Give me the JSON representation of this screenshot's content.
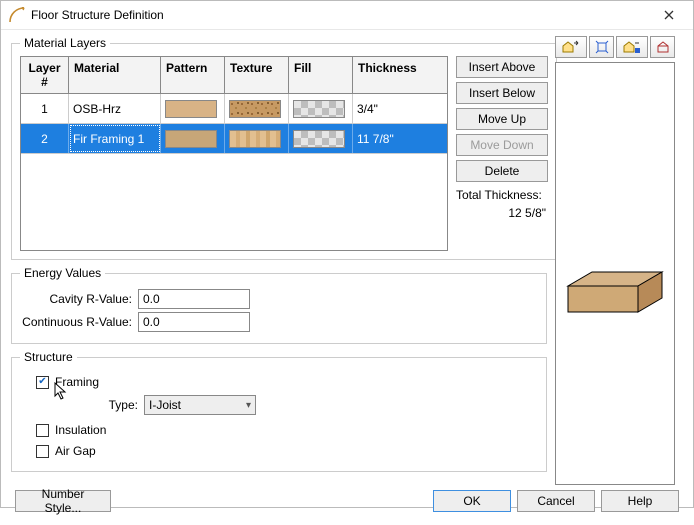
{
  "window": {
    "title": "Floor Structure Definition"
  },
  "sections": {
    "materialLayers": "Material Layers",
    "energyValues": "Energy Values",
    "structure": "Structure"
  },
  "grid": {
    "headers": {
      "layer": "Layer #",
      "material": "Material",
      "pattern": "Pattern",
      "texture": "Texture",
      "fill": "Fill",
      "thickness": "Thickness"
    },
    "rows": [
      {
        "layer": "1",
        "material": "OSB-Hrz",
        "pattern": "wood-light",
        "texture": "osb",
        "fill": "check",
        "thickness": "3/4\"",
        "selected": false
      },
      {
        "layer": "2",
        "material": "Fir Framing 1",
        "pattern": "wood-tan",
        "texture": "fir",
        "fill": "check",
        "thickness": "11 7/8\"",
        "selected": true
      }
    ]
  },
  "sideButtons": {
    "insertAbove": "Insert Above",
    "insertBelow": "Insert Below",
    "moveUp": "Move Up",
    "moveDown": "Move Down",
    "delete": "Delete",
    "totalLabel": "Total Thickness:",
    "totalValue": "12 5/8\""
  },
  "energy": {
    "cavityLabel": "Cavity R-Value:",
    "cavityValue": "0.0",
    "contLabel": "Continuous R-Value:",
    "contValue": "0.0"
  },
  "structure": {
    "framingLabel": "Framing",
    "framingChecked": true,
    "typeLabel": "Type:",
    "typeValue": "I-Joist",
    "insulationLabel": "Insulation",
    "insulationChecked": false,
    "airGapLabel": "Air Gap",
    "airGapChecked": false
  },
  "bottom": {
    "numberStyle": "Number Style...",
    "ok": "OK",
    "cancel": "Cancel",
    "help": "Help"
  }
}
